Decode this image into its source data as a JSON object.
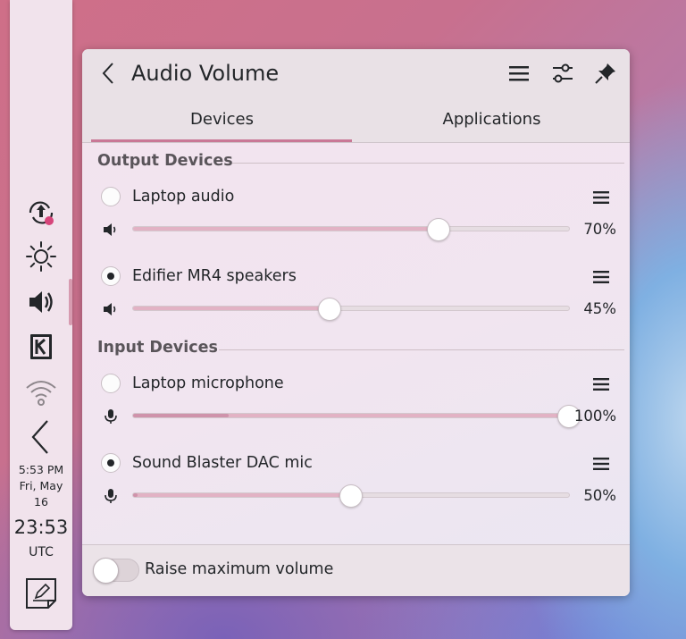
{
  "panel": {
    "clock": {
      "time": "5:53 PM",
      "date_line1": "Fri, May",
      "date_line2": "16",
      "utc_time": "23:53",
      "utc_label": "UTC"
    },
    "tray_icons": [
      "updates-icon",
      "brightness-icon",
      "volume-icon",
      "kde-connect-icon",
      "wifi-icon",
      "collapse-arrow-icon",
      "notes-icon"
    ]
  },
  "popup": {
    "title": "Audio Volume",
    "tabs": [
      {
        "label": "Devices",
        "active": true
      },
      {
        "label": "Applications",
        "active": false
      }
    ],
    "output_section_title": "Output Devices",
    "input_section_title": "Input Devices",
    "output_devices": [
      {
        "name": "Laptop audio",
        "selected": false,
        "volume_percent": 70,
        "volume_label": "70%"
      },
      {
        "name": "Edifier MR4 speakers",
        "selected": true,
        "volume_percent": 45,
        "volume_label": "45%"
      }
    ],
    "input_devices": [
      {
        "name": "Laptop microphone",
        "selected": false,
        "volume_percent": 100,
        "volume_label": "100%",
        "level_percent": 22
      },
      {
        "name": "Sound Blaster DAC mic",
        "selected": true,
        "volume_percent": 50,
        "volume_label": "50%",
        "level_percent": 1
      }
    ],
    "footer": {
      "raise_max_label": "Raise maximum volume",
      "raise_max_enabled": false
    }
  },
  "colors": {
    "accent": "#c97896",
    "slider_fill": "#e2b2c4",
    "level_meter": "#cf93ab"
  }
}
